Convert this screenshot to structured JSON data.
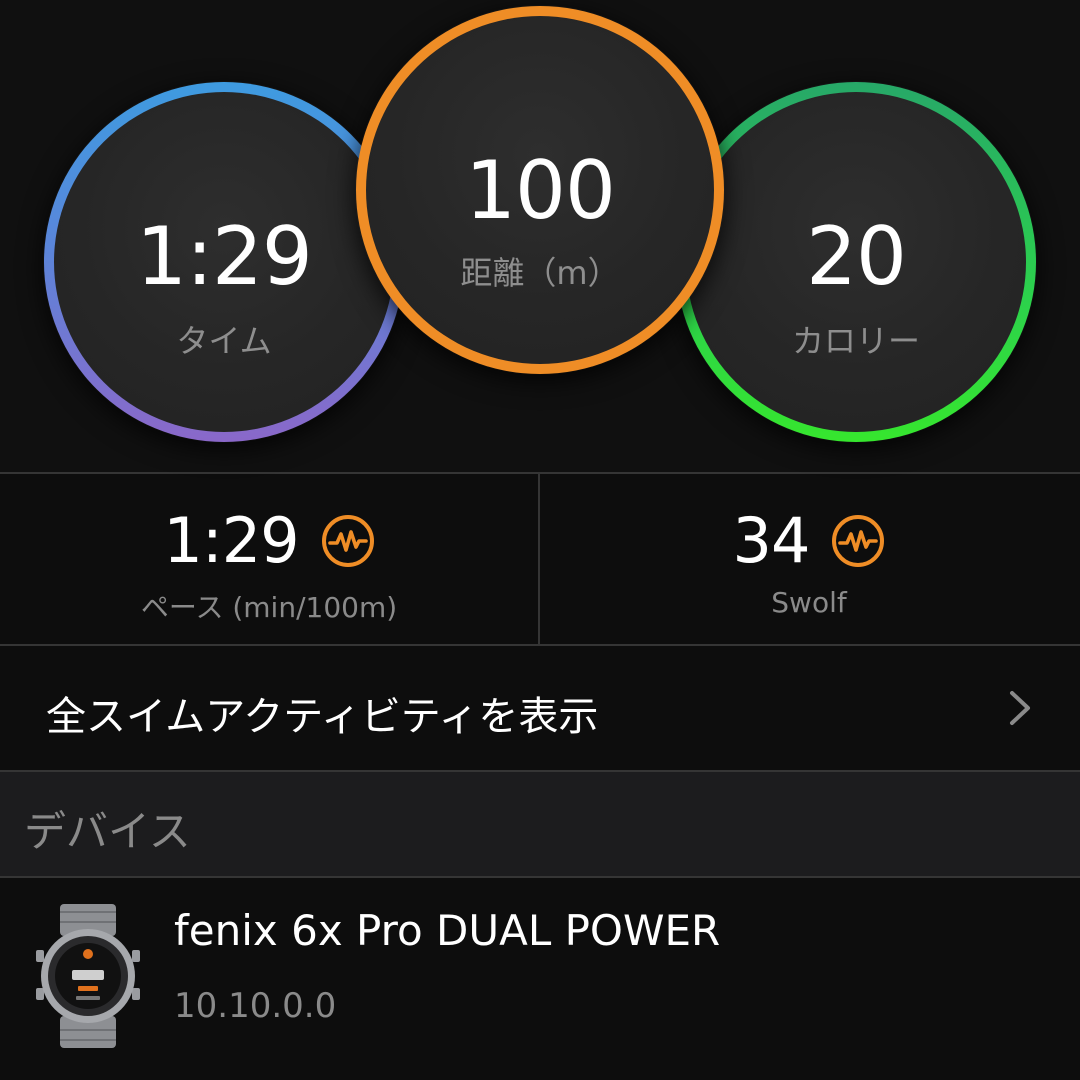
{
  "rings": {
    "time": {
      "value": "1:29",
      "label": "タイム",
      "color_top": "#3e9be0",
      "color_bottom": "#8a68c9"
    },
    "distance": {
      "value": "100",
      "label": "距離（m）",
      "color": "#ef8d26"
    },
    "calories": {
      "value": "20",
      "label": "カロリー",
      "color_top": "#27a868",
      "color_bottom": "#36e62e"
    }
  },
  "stats": {
    "pace": {
      "value": "1:29",
      "label": "ペース (min/100m)",
      "icon": "heart-rate-icon"
    },
    "swolf": {
      "value": "34",
      "label": "Swolf",
      "icon": "heart-rate-icon"
    }
  },
  "link": {
    "label": "全スイムアクティビティを表示",
    "icon": "chevron-right-icon"
  },
  "section": {
    "title": "デバイス"
  },
  "device": {
    "name": "fenix 6x Pro DUAL POWER",
    "version": "10.10.0.0",
    "icon": "watch-icon"
  },
  "colors": {
    "accent_orange": "#ef8d26",
    "background": "#0d0d0d",
    "section_bg": "#1c1c1e"
  }
}
